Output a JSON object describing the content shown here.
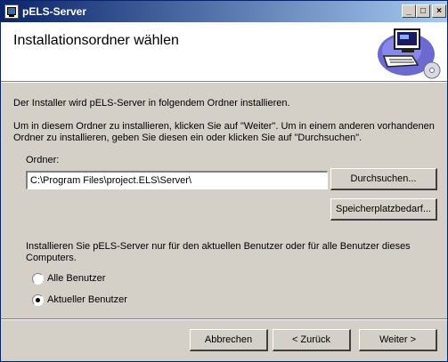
{
  "window": {
    "title": "pELS-Server"
  },
  "header": {
    "title": "Installationsordner wählen"
  },
  "body": {
    "intro": "Der Installer wird pELS-Server in folgendem Ordner installieren.",
    "instruction_line1": "Um in diesem Ordner zu installieren, klicken Sie auf \"Weiter\". Um in einem anderen vorhandenen",
    "instruction_line2": "Ordner zu installieren, geben Sie diesen ein oder klicken Sie auf \"Durchsuchen\"."
  },
  "folder": {
    "label": "Ordner:",
    "value": "C:\\Program Files\\project.ELS\\Server\\",
    "browse_label": "Durchsuchen...",
    "disk_cost_label": "Speicherplatzbedarf..."
  },
  "install_for": {
    "prompt_line1": "Installieren Sie pELS-Server nur für den aktuellen Benutzer oder für alle Benutzer dieses",
    "prompt_line2": "Computers.",
    "options": [
      {
        "label": "Alle Benutzer",
        "checked": false
      },
      {
        "label": "Aktueller Benutzer",
        "checked": true
      }
    ]
  },
  "footer": {
    "cancel_label": "Abbrechen",
    "back_label": "< Zurück",
    "next_label": "Weiter >"
  }
}
